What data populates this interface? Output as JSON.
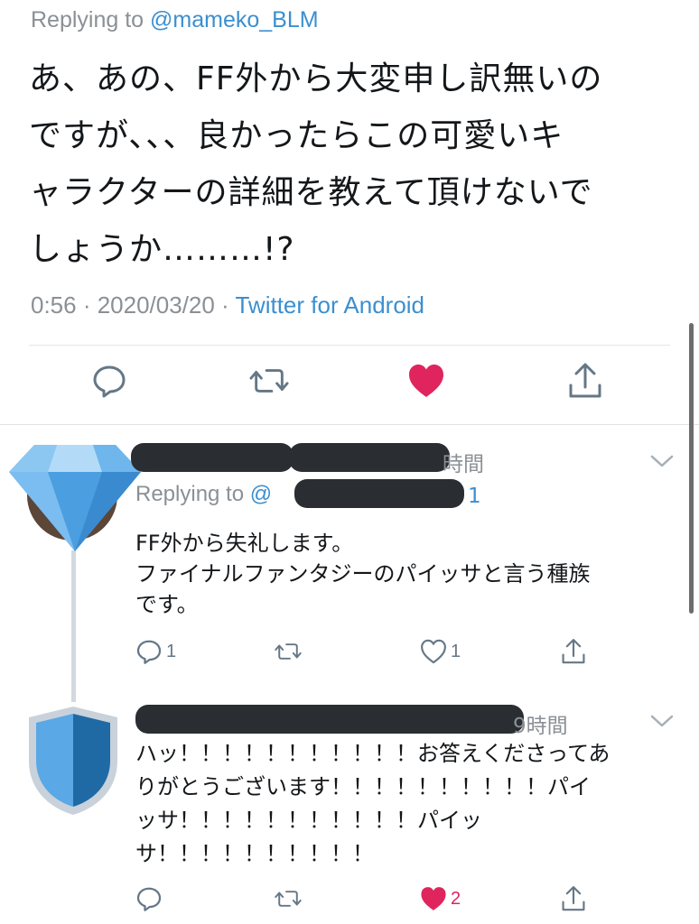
{
  "main_tweet": {
    "replying_prefix": "Replying to ",
    "replying_handle": "@mameko_BLM",
    "text_lines": [
      "あ、あの、FF外から大変申し訳無いの",
      "ですが、、、良かったらこの可愛いキ",
      "ャラクターの詳細を教えて頂けないで",
      "しょうか………!?"
    ],
    "time": "0:56 · 2020/03/20 · ",
    "source": "Twitter for Android",
    "liked": true,
    "like_color": "#e0245e",
    "icons": [
      "reply-icon",
      "retweet-icon",
      "like-icon",
      "share-icon"
    ]
  },
  "replies": [
    {
      "time_suffix": "時間",
      "replying_prefix": "Replying to ",
      "replying_handle_visible": "@",
      "replying_handle_tail": "1",
      "text_lines": [
        "FF外から失礼します。",
        "ファイナルファンタジーのパイッサと言う種族",
        "です。"
      ],
      "reply_count": "1",
      "like_count": "1",
      "liked": false,
      "avatar_icon": "crystal-gem-icon"
    },
    {
      "time_suffix": "9時間",
      "text_lines": [
        "ハッ！！！！！！！！！！！お答えくださってあ",
        "りがとうございます！！！！！！！！！！パイ",
        "ッサ！！！！！！！！！！！パイッ",
        "サ！！！！！！！！！！"
      ],
      "like_count": "2",
      "liked": true,
      "avatar_icon": "shield-icon"
    }
  ],
  "colors": {
    "link": "#3b8fd0",
    "muted": "#8a9095",
    "like": "#e0245e",
    "icon": "#657786",
    "redaction": "#2a2e32"
  }
}
